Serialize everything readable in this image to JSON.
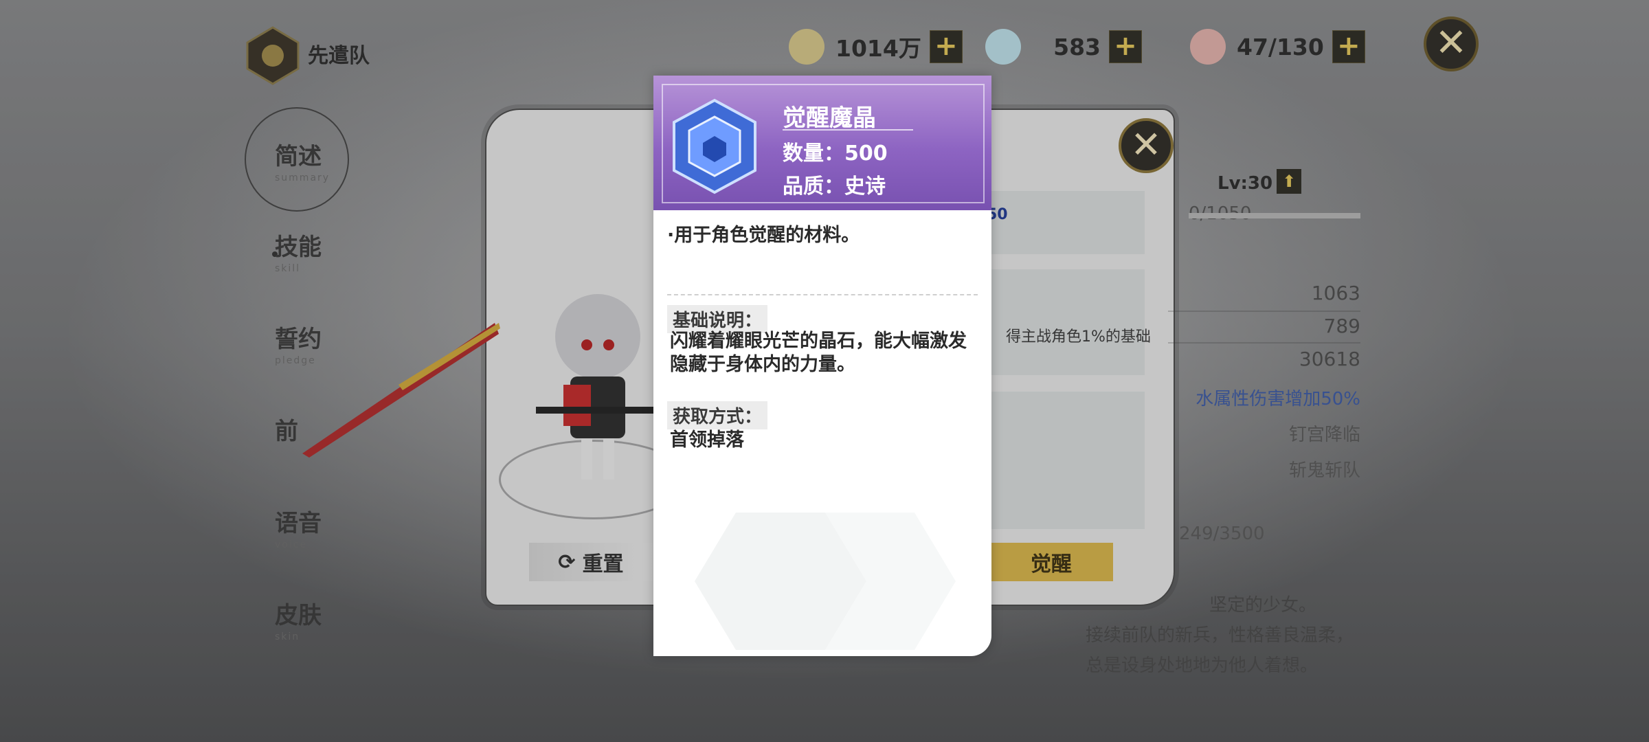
{
  "topbar": {
    "logo_text": "先遣队",
    "resources": [
      {
        "name": "gold",
        "value": "1014万",
        "plus": "+"
      },
      {
        "name": "gem",
        "value": "583",
        "plus": "+"
      },
      {
        "name": "stamina",
        "value": "47/130",
        "plus": "+"
      }
    ],
    "close": "✕"
  },
  "nav": {
    "items": [
      {
        "label": "简述",
        "sub": "summary"
      },
      {
        "label": "技能",
        "sub": "skill"
      },
      {
        "label": "誓约",
        "sub": "pledge"
      },
      {
        "label": "前",
        "sub": ""
      },
      {
        "label": "语音",
        "sub": "voice"
      },
      {
        "label": "皮肤",
        "sub": "skin"
      }
    ]
  },
  "panel": {
    "reset_label": "重置",
    "awaken_label": "觉醒",
    "close": "✕",
    "level": "Lv:30",
    "level_up": "⬆",
    "exp": "0/1050",
    "partial_value": "50",
    "partial_desc": "得主战角色1%的基础",
    "stats": [
      "1063",
      "789",
      "30618"
    ],
    "bonus": "水属性伤害增加50%",
    "tags": [
      "钉宫降临",
      "斩鬼斩队"
    ],
    "awaken_progress": "249/3500",
    "desc_lines": [
      "坚定的少女。",
      "接续前队的新兵，性格善良温柔，",
      "总是设身处地地为他人着想。"
    ]
  },
  "popup": {
    "name": "觉醒魔晶",
    "quantity": "数量：500",
    "quality": "品质：史诗",
    "usage": "·用于角色觉醒的材料。",
    "basic_title": "基础说明：",
    "basic_text": "闪耀着耀眼光芒的晶石，能大幅激发隐藏于身体内的力量。",
    "obtain_title": "获取方式：",
    "obtain_text": "首领掉落"
  },
  "colors": {
    "popup_header": "#8d64c2",
    "accent_gold": "#d9b64a",
    "button_dark": "#2e2b25"
  }
}
